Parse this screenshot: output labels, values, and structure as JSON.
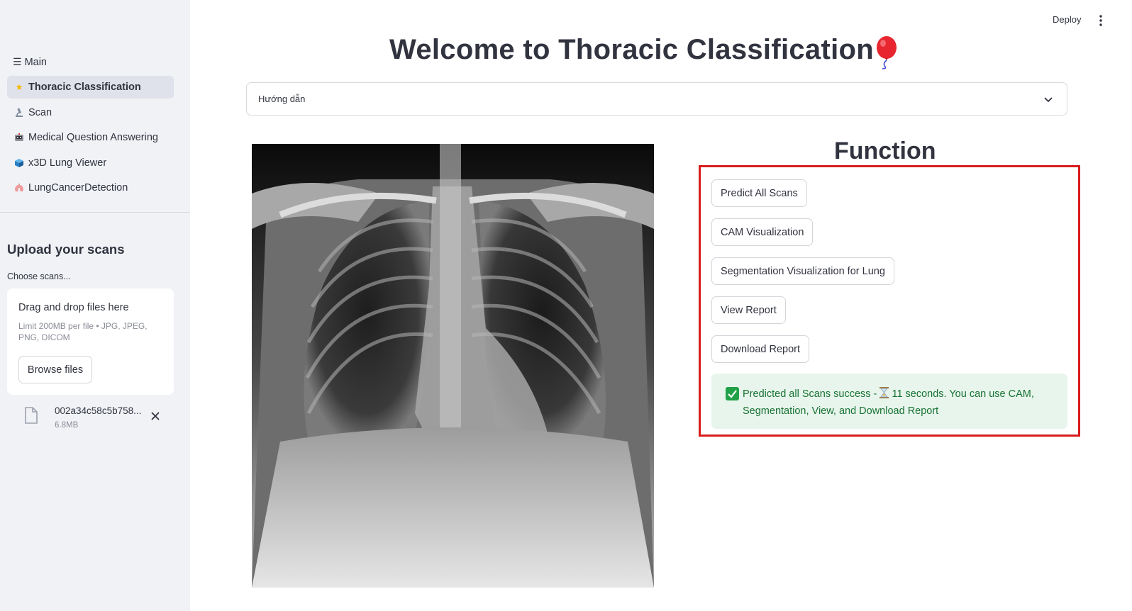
{
  "sidebar": {
    "nav_header": "Main",
    "nav_items": [
      {
        "label": "Thoracic Classification",
        "icon": "star-icon"
      },
      {
        "label": "Scan",
        "icon": "microscope-icon"
      },
      {
        "label": "Medical Question Answering",
        "icon": "robot-icon"
      },
      {
        "label": "x3D Lung Viewer",
        "icon": "cube-icon"
      },
      {
        "label": "LungCancerDetection",
        "icon": "lungs-icon"
      }
    ],
    "upload_title": "Upload your scans",
    "upload_label": "Choose scans...",
    "dropzone_title": "Drag and drop files here",
    "dropzone_limit": "Limit 200MB per file • JPG, JPEG, PNG, DICOM",
    "browse_label": "Browse files",
    "file": {
      "name": "002a34c58c5b758...",
      "size": "6.8MB"
    }
  },
  "header": {
    "deploy_label": "Deploy"
  },
  "main": {
    "title": "Welcome to Thoracic Classification",
    "expander_label": "Hướng dẫn",
    "function_title": "Function",
    "buttons": [
      "Predict All Scans",
      "CAM Visualization",
      "Segmentation Visualization for Lung",
      "View Report",
      "Download Report"
    ],
    "success_text_1": "Predicted all Scans success - ",
    "success_text_2": " 11 seconds. You can use CAM, Segmentation, View, and Download Report"
  },
  "colors": {
    "sidebar_bg": "#f0f2f6",
    "highlight_border": "#d91c1c",
    "success_bg": "#e8f5ec",
    "success_text": "#177233"
  }
}
